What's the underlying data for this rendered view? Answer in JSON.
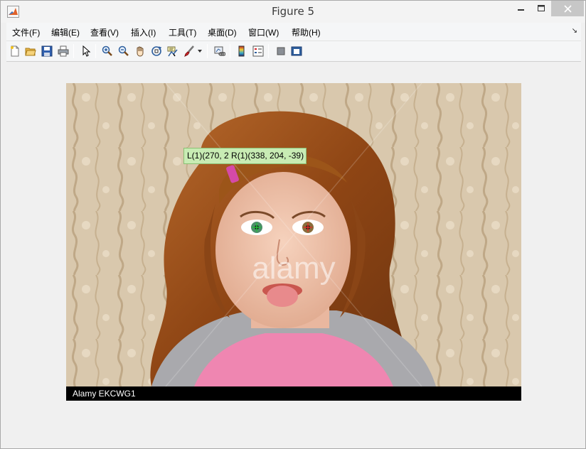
{
  "window": {
    "title": "Figure 5"
  },
  "menu": {
    "items": [
      {
        "label": "文件(F)"
      },
      {
        "label": "编辑(E)"
      },
      {
        "label": "查看(V)"
      },
      {
        "label": "插入(I)"
      },
      {
        "label": "工具(T)"
      },
      {
        "label": "桌面(D)"
      },
      {
        "label": "窗口(W)"
      },
      {
        "label": "帮助(H)"
      }
    ],
    "dock_glyph": "↘"
  },
  "toolbar": {
    "icons": [
      "new-figure-icon",
      "open-file-icon",
      "save-icon",
      "print-icon",
      "edit-plot-arrow-icon",
      "zoom-in-icon",
      "zoom-out-icon",
      "pan-hand-icon",
      "rotate-3d-icon",
      "data-cursor-icon",
      "brush-icon",
      "brush-dropdown-icon",
      "link-plot-icon",
      "colorbar-icon",
      "legend-icon",
      "hide-plot-tools-icon",
      "show-plot-tools-icon"
    ]
  },
  "figure": {
    "datatip_text": "L(1)(270, 2 R(1)(338, 204, -39)",
    "caption": "Alamy EKCWG1",
    "watermark": "alamy"
  },
  "colors": {
    "datatip_bg": "#c8ecb4",
    "caption_bg": "#000000",
    "close_button_bg": "#c7c7c7"
  }
}
